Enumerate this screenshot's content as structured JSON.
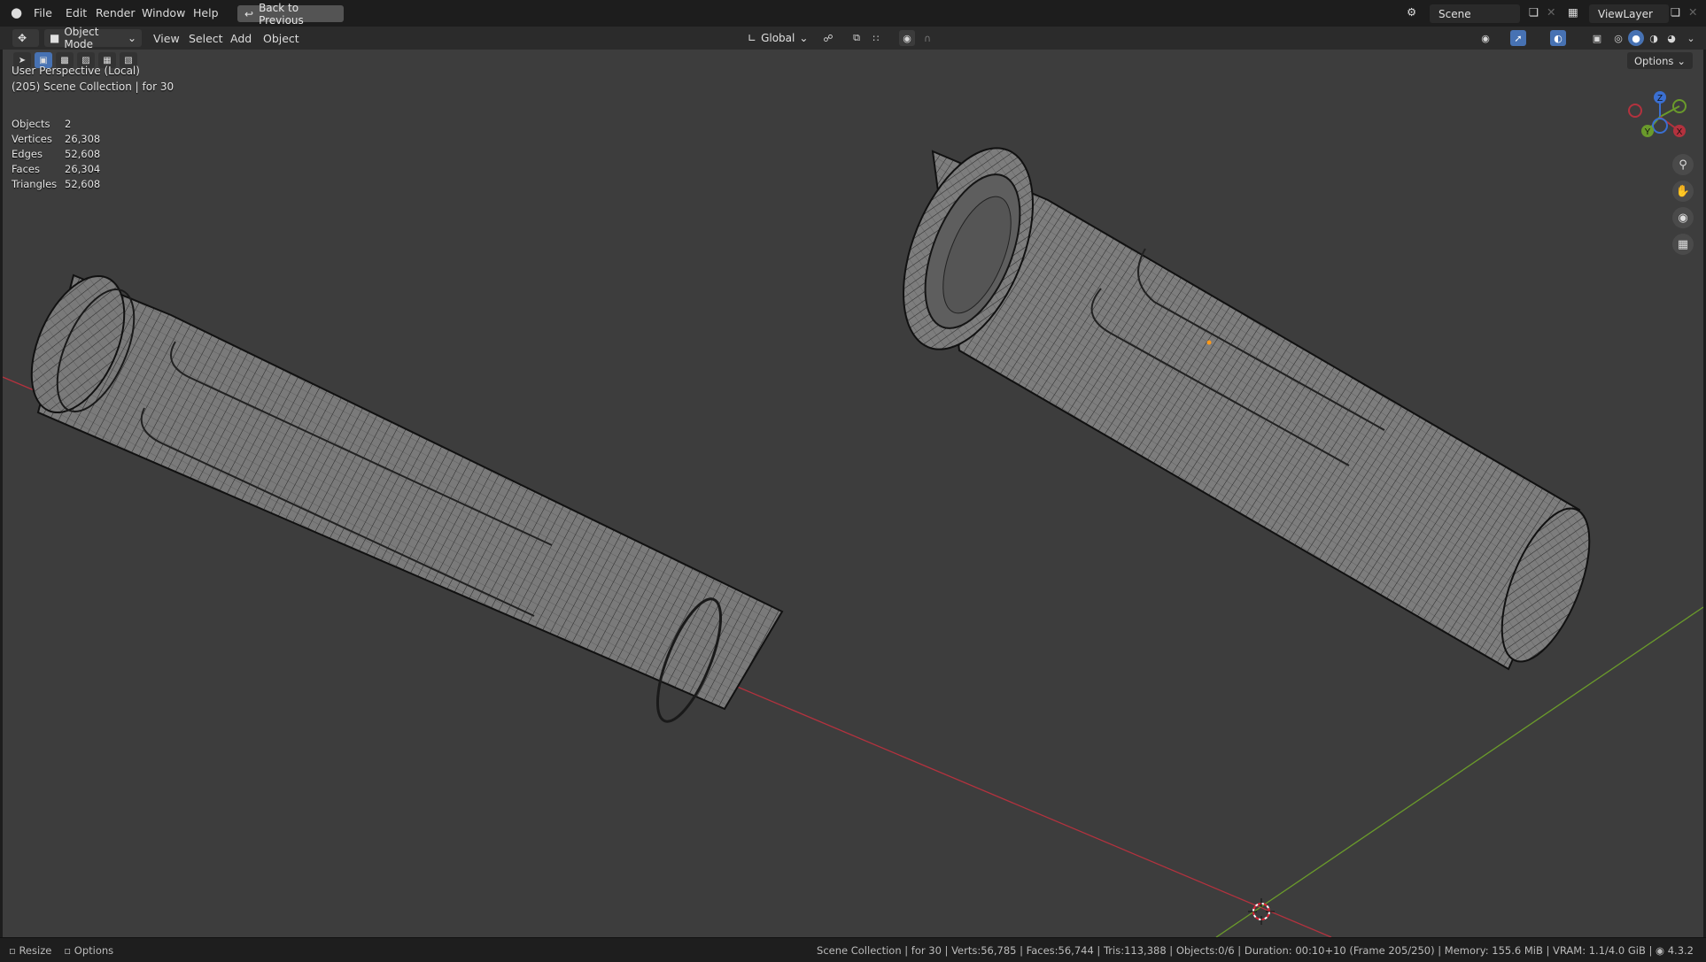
{
  "topbar": {
    "menus": [
      "File",
      "Edit",
      "Render",
      "Window",
      "Help"
    ],
    "back_label": "Back to Previous",
    "scene_name": "Scene",
    "view_layer": "ViewLayer"
  },
  "header": {
    "mode": "Object Mode",
    "menus": [
      "View",
      "Select",
      "Add",
      "Object"
    ],
    "transform_orientation": "Global"
  },
  "viewport": {
    "perspective": "User Perspective (Local)",
    "collection_line": "(205) Scene Collection | for 30",
    "options_label": "Options",
    "stats": [
      {
        "label": "Objects",
        "value": "2"
      },
      {
        "label": "Vertices",
        "value": "26,308"
      },
      {
        "label": "Edges",
        "value": "52,608"
      },
      {
        "label": "Faces",
        "value": "26,304"
      },
      {
        "label": "Triangles",
        "value": "52,608"
      }
    ],
    "gizmo": {
      "x": "X",
      "y": "Y",
      "z": "Z"
    }
  },
  "statusbar": {
    "left": [
      "Resize",
      "Options"
    ],
    "info": "Scene Collection | for 30 | Verts:56,785 | Faces:56,744 | Tris:113,388 | Objects:0/6 | Duration: 00:10+10 (Frame 205/250) | Memory: 155.6 MiB | VRAM: 1.1/4.0 GiB |",
    "version": "4.3.2"
  },
  "colors": {
    "x_axis": "#b3323e",
    "y_axis": "#6a9a2b",
    "z_axis": "#3a6fd1",
    "accent": "#4772b3"
  }
}
